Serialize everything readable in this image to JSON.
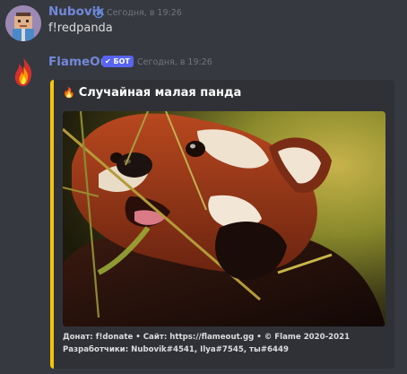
{
  "messages": [
    {
      "username": "Nubovik",
      "user_badge_icon": "verified-owner-icon",
      "username_color": "#7289da",
      "timestamp": "Сегодня, в 19:26",
      "content": "f!redpanda"
    },
    {
      "username": "FlameOut",
      "username_color": "#7289da",
      "bot_tag": "✔ БОТ",
      "timestamp": "Сегодня, в 19:26",
      "embed": {
        "accent_color": "#f1c40f",
        "title_icon": "🔥",
        "title": "Случайная малая панда",
        "image_subject": "red-panda",
        "footer_line1": "Донат: f!donate • Сайт: https://flameout.gg • © Flame 2020-2021",
        "footer_line2": "Разработчики: Nubovik#4541, Ilya#7545, ты#6449"
      }
    }
  ]
}
